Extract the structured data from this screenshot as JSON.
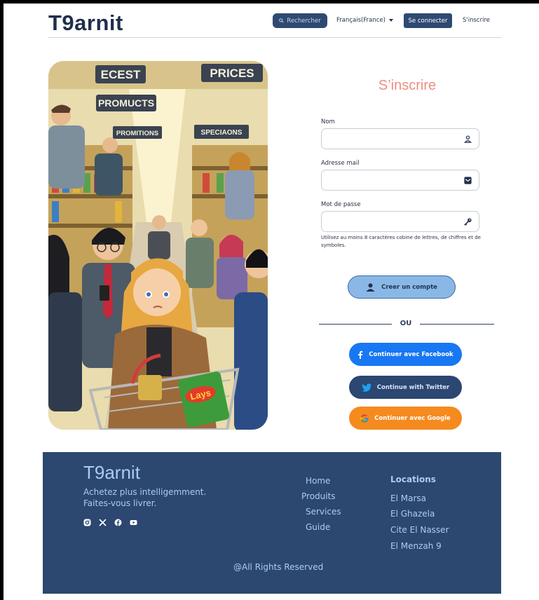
{
  "header": {
    "logo": "T9arnit",
    "search_label": "Rechercher",
    "language": "Français(France)",
    "login_label": "Se connecter",
    "signup_label": "S'inscrire"
  },
  "hero": {
    "signs": [
      "ECEST",
      "PRICES",
      "PROMUCTS",
      "PROMITIONS",
      "SPECIAONS"
    ],
    "product_label": "Lays"
  },
  "form": {
    "title": "S’inscrire",
    "name_label": "Nom",
    "email_label": "Adresse mail",
    "password_label": "Mot de passe",
    "password_hint": "Utilisez au moins 8 caractères cobine de lettres, de chiffres et de symboles.",
    "create_label": "Creer un compte",
    "or_label": "OU",
    "facebook_label": "Continuer avec Facebook",
    "twitter_label": "Continue with Twitter",
    "google_label": "Continuer avec Google"
  },
  "footer": {
    "logo": "T9arnit",
    "tagline_1": "Achetez plus intelligemment.",
    "tagline_2": "Faites-vous livrer.",
    "social_icons": [
      "instagram-icon",
      "x-icon",
      "facebook-icon",
      "youtube-icon"
    ],
    "nav": [
      "Home",
      "Produits",
      "Services",
      "Guide"
    ],
    "locations_title": "Locations",
    "locations": [
      "El Marsa",
      "El Ghazela",
      "Cite El Nasser",
      "El Menzah 9"
    ],
    "rights": "@All Rights Reserved"
  },
  "colors": {
    "navy": "#2c4770",
    "title_coral": "#ef8d80",
    "facebook_blue": "#1877f2",
    "google_orange": "#f58a1f",
    "create_blue": "#8ab8e6"
  }
}
